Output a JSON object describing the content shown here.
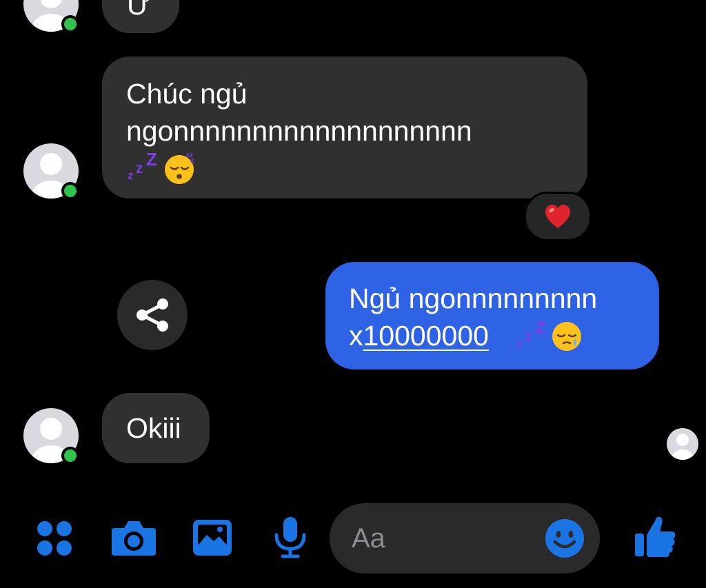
{
  "conversation": {
    "messages": [
      {
        "sender": "contact",
        "text": "Ừ",
        "partially_visible": true
      },
      {
        "sender": "contact",
        "line1": "Chúc ngủ",
        "line2": "ngonnnnnnnnnnnnnnnnnnn",
        "emojis": [
          "zzz",
          "sleeping-face"
        ],
        "reaction": "red-heart"
      },
      {
        "sender": "me",
        "line1": "Ngủ ngonnnnnnnnn",
        "prefix": "x",
        "link": "10000000",
        "emojis": [
          "zzz",
          "sleepy-face"
        ]
      },
      {
        "sender": "contact",
        "text": "Okiii"
      }
    ]
  },
  "composer": {
    "placeholder": "Aa",
    "actions": [
      "menu-grid",
      "camera",
      "gallery",
      "microphone"
    ],
    "send_action": "thumbs-up"
  },
  "colors": {
    "background": "#000000",
    "incoming_bubble": "#303030",
    "outgoing_bubble": "#2f63e6",
    "accent": "#1b74e4",
    "online": "#31c24d",
    "heart": "#e0242e"
  }
}
